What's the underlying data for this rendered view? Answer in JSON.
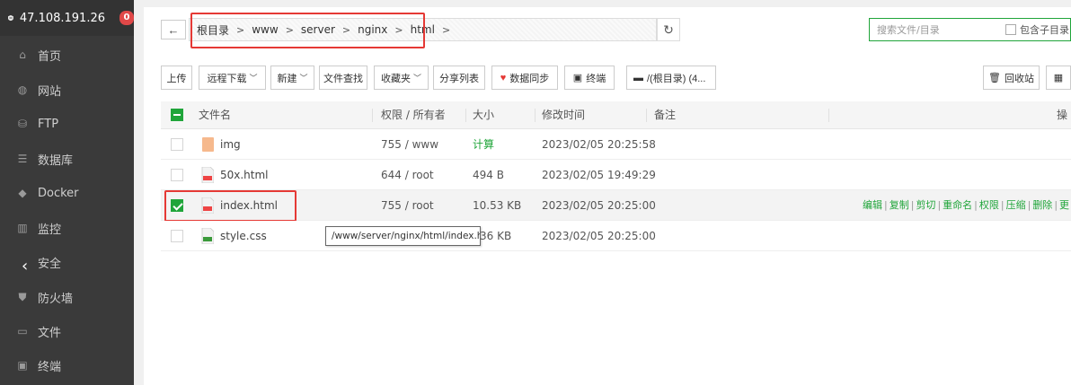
{
  "sidebar": {
    "server_ip": "47.108.191.26",
    "badge_count": "0",
    "items": [
      {
        "label": "首页",
        "icon": "home-icon"
      },
      {
        "label": "网站",
        "icon": "globe-icon"
      },
      {
        "label": "FTP",
        "icon": "ftp-icon"
      },
      {
        "label": "数据库",
        "icon": "database-icon"
      },
      {
        "label": "Docker",
        "icon": "docker-icon"
      },
      {
        "label": "监控",
        "icon": "monitor-icon"
      },
      {
        "label": "安全",
        "icon": "security-icon"
      },
      {
        "label": "防火墙",
        "icon": "firewall-icon"
      },
      {
        "label": "文件",
        "icon": "folder-icon"
      },
      {
        "label": "终端",
        "icon": "terminal-icon"
      }
    ]
  },
  "pathbar": {
    "crumbs": [
      "根目录",
      "www",
      "server",
      "nginx",
      "html"
    ]
  },
  "search": {
    "placeholder": "搜索文件/目录",
    "include_sub_label": "包含子目录"
  },
  "toolbar": {
    "upload": "上传",
    "remote_download": "远程下载",
    "new": "新建",
    "file_search": "文件查找",
    "favorites": "收藏夹",
    "share_list": "分享列表",
    "data_sync": "数据同步",
    "terminal": "终端",
    "disk": "/(根目录) (4...",
    "recycle_bin": "回收站"
  },
  "table": {
    "headers": {
      "name": "文件名",
      "perm_owner": "权限 / 所有者",
      "size": "大小",
      "mtime": "修改时间",
      "remark": "备注",
      "ops": "操"
    },
    "rows": [
      {
        "name": "img",
        "type": "folder",
        "perm": "755 / www",
        "size": "计算",
        "mtime": "2023/02/05 20:25:58",
        "selected": false
      },
      {
        "name": "50x.html",
        "type": "file",
        "perm": "644 / root",
        "size": "494 B",
        "mtime": "2023/02/05 19:49:29",
        "selected": false
      },
      {
        "name": "index.html",
        "type": "file",
        "perm": "755 / root",
        "size": "10.53 KB",
        "mtime": "2023/02/05 20:25:00",
        "selected": true
      },
      {
        "name": "style.css",
        "type": "file",
        "perm": "",
        "size": "36 KB",
        "mtime": "2023/02/05 20:25:00",
        "selected": false
      }
    ],
    "row_ops": [
      "编辑",
      "复制",
      "剪切",
      "重命名",
      "权限",
      "压缩",
      "删除",
      "更"
    ]
  },
  "tooltip": "/www/server/nginx/html/index.html",
  "colors": {
    "accent": "#20a53a",
    "highlight": "#e53935",
    "sidebar_bg": "#3a3a3a"
  }
}
